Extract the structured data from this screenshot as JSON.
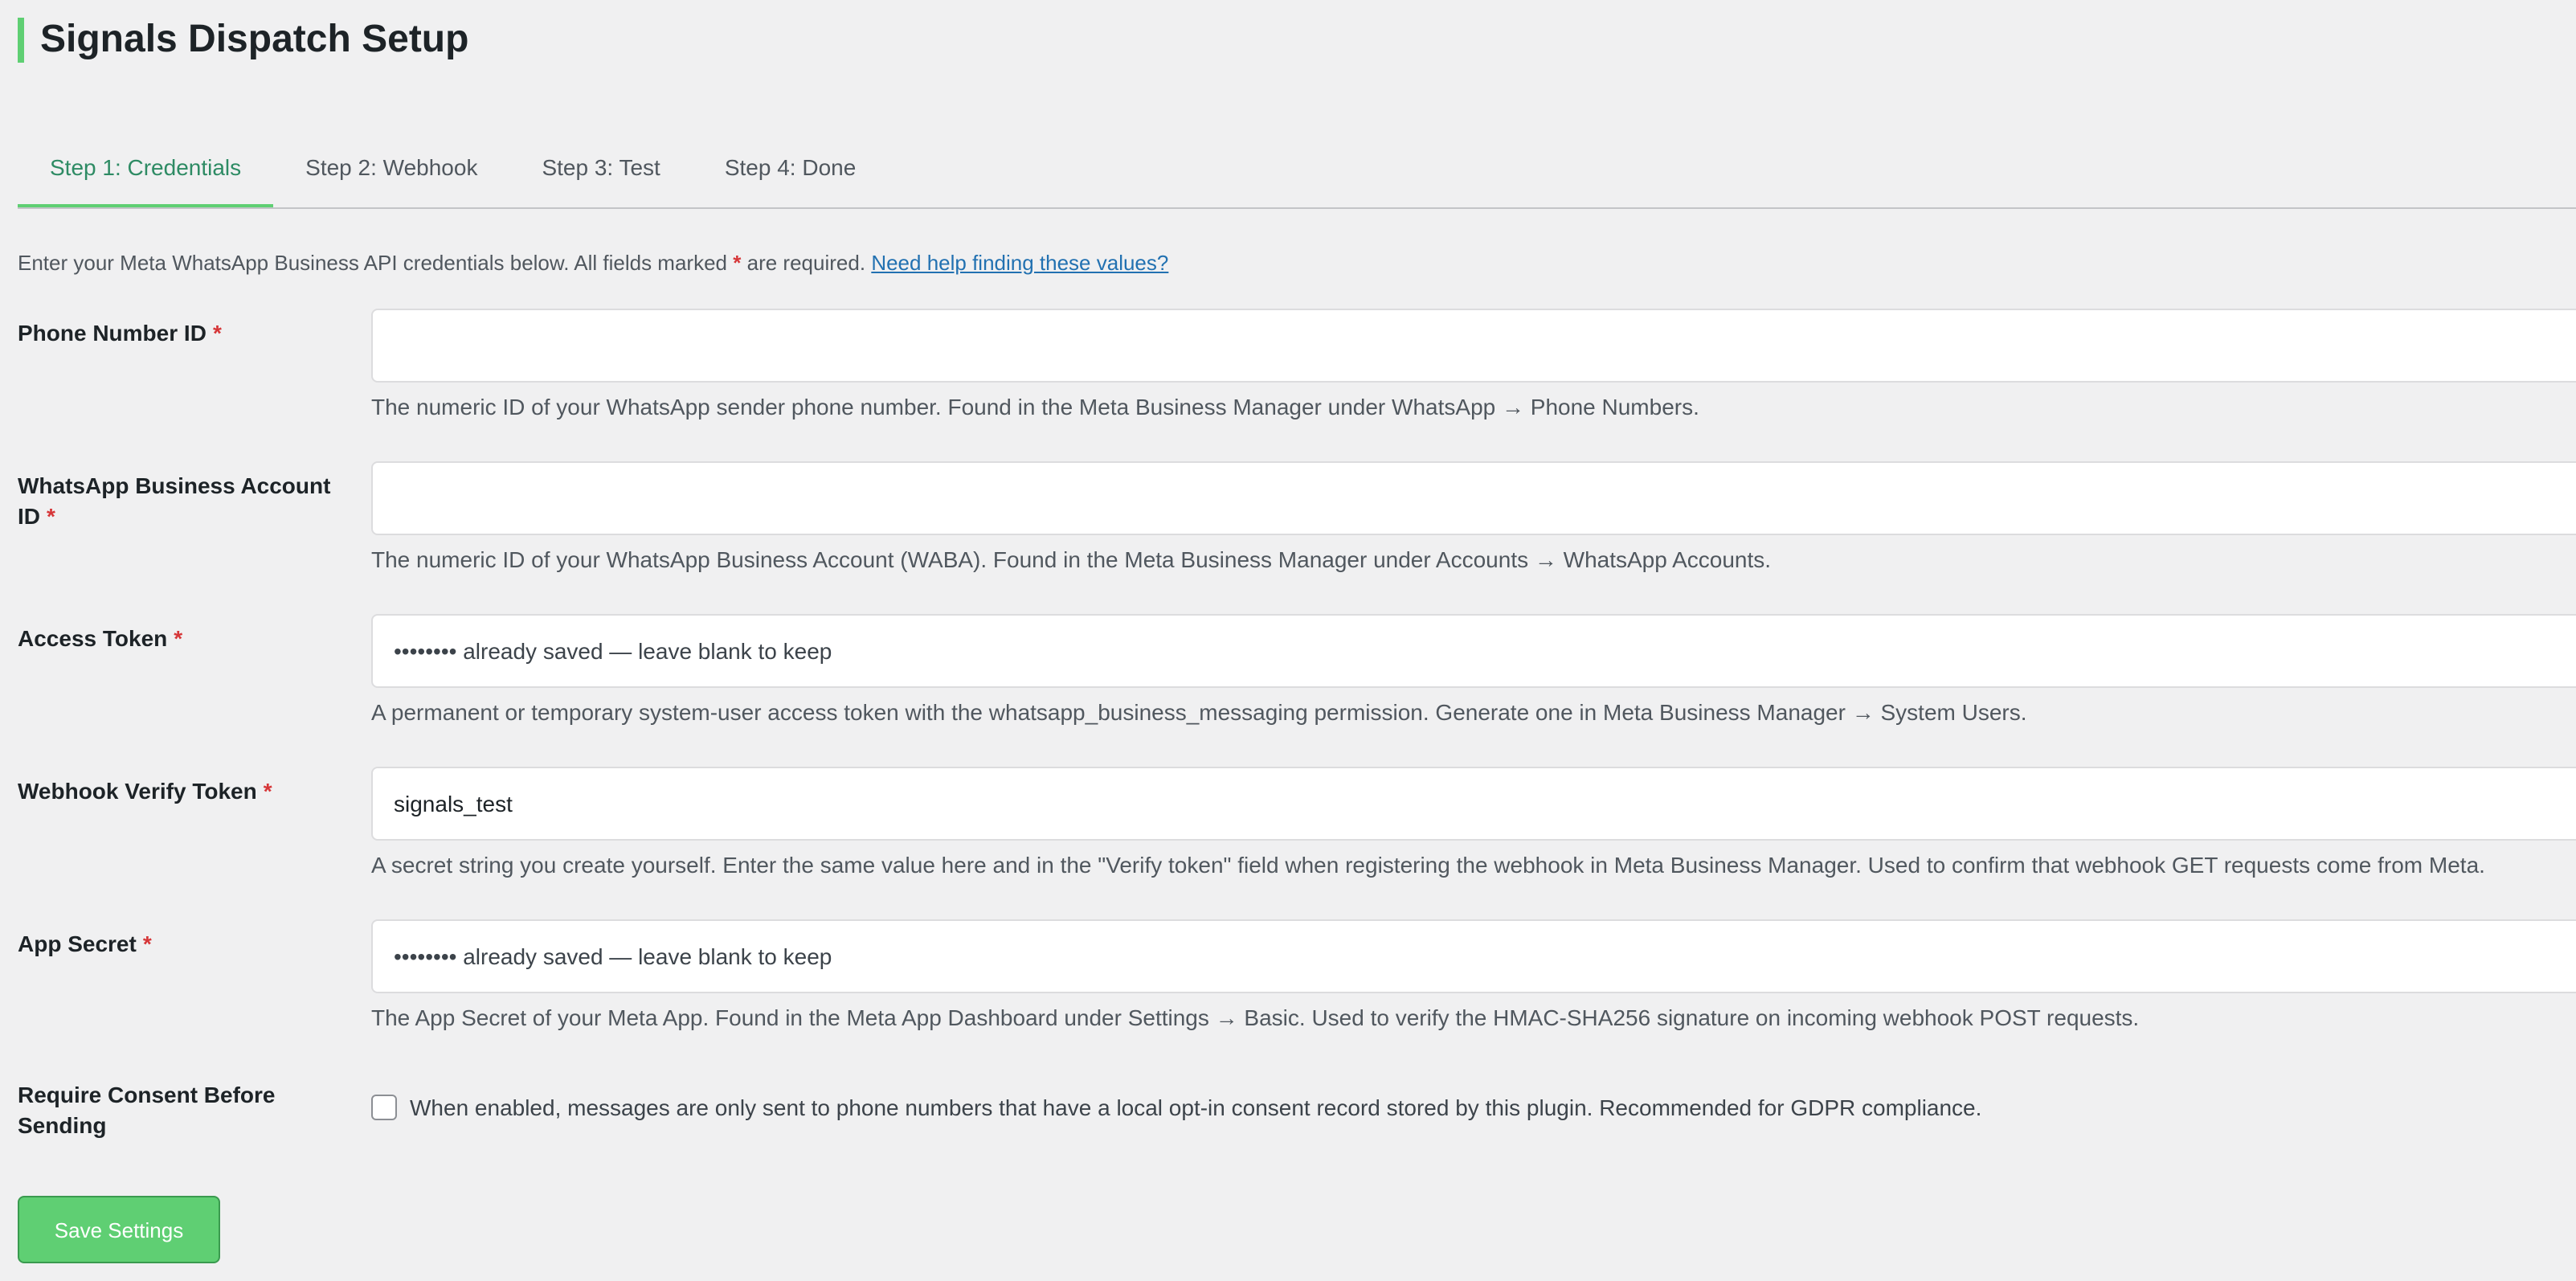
{
  "page": {
    "title": "Signals Dispatch Setup"
  },
  "tabs": [
    {
      "label": "Step 1: Credentials",
      "active": true
    },
    {
      "label": "Step 2: Webhook",
      "active": false
    },
    {
      "label": "Step 3: Test",
      "active": false
    },
    {
      "label": "Step 4: Done",
      "active": false
    }
  ],
  "intro": {
    "text_before": "Enter your Meta WhatsApp Business API credentials below. All fields marked",
    "required_marker": "*",
    "text_after": "are required.",
    "help_link": "Need help finding these values?"
  },
  "fields": [
    {
      "label": "Phone Number ID",
      "required_marker": "*",
      "value": "",
      "placeholder": "",
      "description": "The numeric ID of your WhatsApp sender phone number. Found in the Meta Business Manager under WhatsApp → Phone Numbers."
    },
    {
      "label": "WhatsApp Business Account ID",
      "required_marker": "*",
      "value": "",
      "placeholder": "",
      "description": "The numeric ID of your WhatsApp Business Account (WABA). Found in the Meta Business Manager under Accounts → WhatsApp Accounts."
    },
    {
      "label": "Access Token",
      "required_marker": "*",
      "value": "",
      "placeholder": "•••••••• already saved — leave blank to keep",
      "description": "A permanent or temporary system-user access token with the whatsapp_business_messaging permission. Generate one in Meta Business Manager → System Users."
    },
    {
      "label": "Webhook Verify Token",
      "required_marker": "*",
      "value": "signals_test",
      "placeholder": "",
      "description": "A secret string you create yourself. Enter the same value here and in the \"Verify token\" field when registering the webhook in Meta Business Manager. Used to confirm that webhook GET requests come from Meta."
    },
    {
      "label": "App Secret",
      "required_marker": "*",
      "value": "",
      "placeholder": "•••••••• already saved — leave blank to keep",
      "description": "The App Secret of your Meta App. Found in the Meta App Dashboard under Settings → Basic. Used to verify the HMAC-SHA256 signature on incoming webhook POST requests."
    }
  ],
  "consent": {
    "label": "Require Consent Before Sending",
    "checked": false,
    "description": "When enabled, messages are only sent to phone numbers that have a local opt-in consent record stored by this plugin. Recommended for GDPR compliance."
  },
  "actions": {
    "save_label": "Save Settings"
  },
  "colors": {
    "accent": "#5fcf73",
    "active_tab": "#2e8b64",
    "required": "#d63638",
    "link": "#2271b1",
    "background": "#f0f0f1"
  }
}
